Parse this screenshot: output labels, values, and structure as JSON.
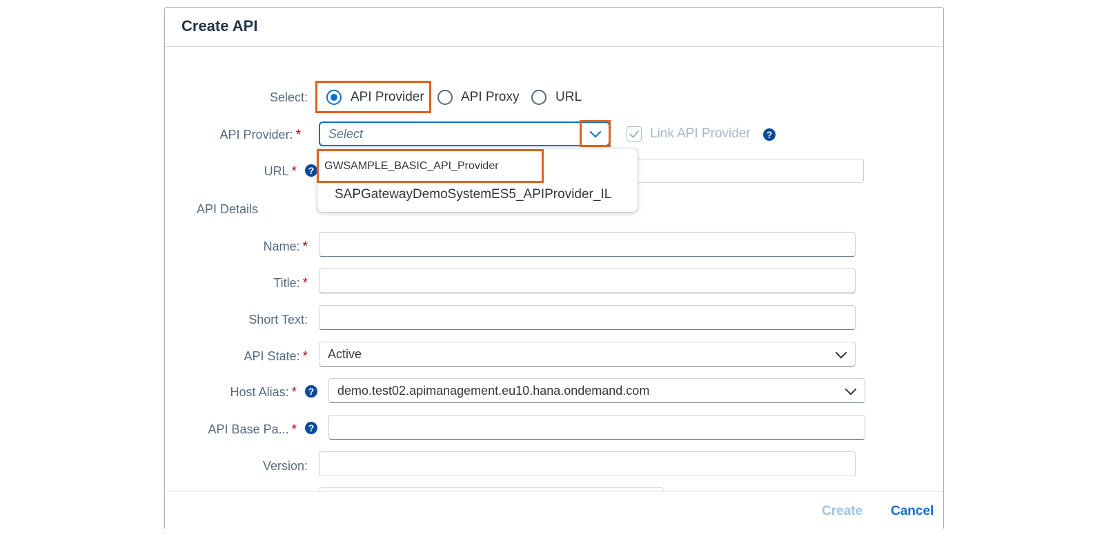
{
  "dialog": {
    "title": "Create API"
  },
  "select_row": {
    "label": "Select:",
    "options": [
      {
        "label": "API Provider",
        "checked": true
      },
      {
        "label": "API Proxy",
        "checked": false
      },
      {
        "label": "URL",
        "checked": false
      }
    ]
  },
  "api_provider": {
    "label": "API Provider:",
    "required": "*",
    "placeholder": "Select",
    "link_label": "Link API Provider",
    "help": "?",
    "dropdown_items": [
      "GWSAMPLE_BASIC_API_Provider",
      "SAPGatewayDemoSystemES5_APIProvider_IL"
    ]
  },
  "url": {
    "label": "URL",
    "required": "*",
    "help": "?"
  },
  "details": {
    "section_title": "API Details",
    "name_label": "Name:",
    "title_label": "Title:",
    "short_text_label": "Short Text:",
    "api_state_label": "API State:",
    "api_state_value": "Active",
    "host_alias_label": "Host Alias:",
    "host_alias_value": "demo.test02.apimanagement.eu10.hana.ondemand.com",
    "base_path_label": "API Base Pa...",
    "version_label": "Version:",
    "required": "*",
    "help": "?"
  },
  "footer": {
    "create_label": "Create",
    "cancel_label": "Cancel"
  },
  "colors": {
    "highlight": "#e0601c",
    "accent": "#0a6ed1",
    "required": "#aa0808"
  }
}
